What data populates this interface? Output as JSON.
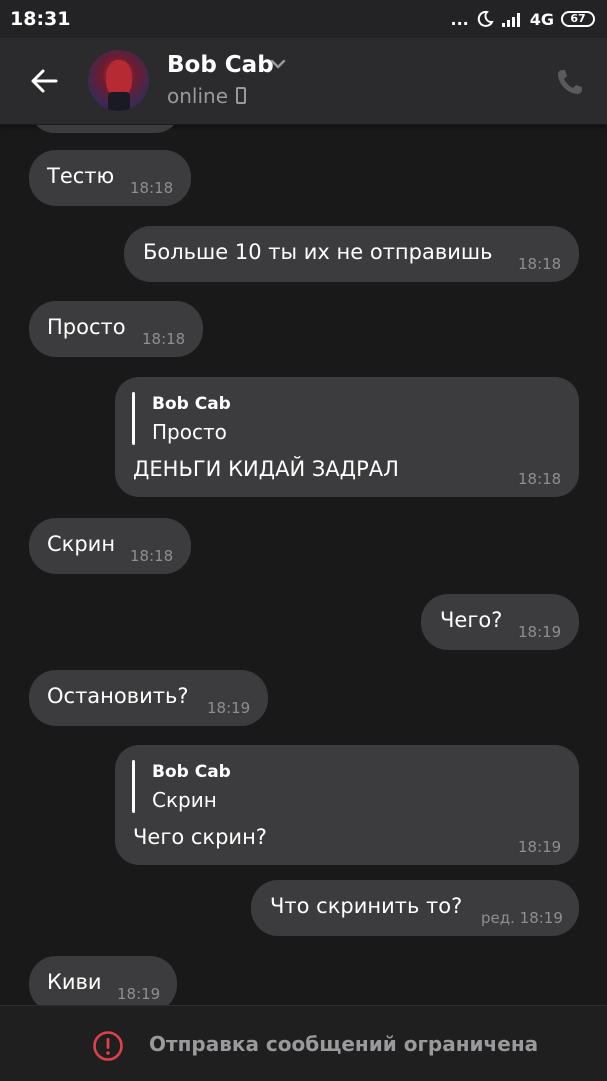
{
  "status_bar": {
    "time": "18:31",
    "dots": "...",
    "network": "4G",
    "battery": "67"
  },
  "header": {
    "contact_name": "Bob Cab",
    "contact_status": "online",
    "accent_icon_color": "#9a9a9c"
  },
  "messages": [
    {
      "side": "in",
      "text": "Тестю",
      "time": "18:18"
    },
    {
      "side": "out",
      "text": "Больше 10 ты их не отправишь",
      "time": "18:18"
    },
    {
      "side": "in",
      "text": "Просто",
      "time": "18:18"
    },
    {
      "side": "out",
      "reply_name": "Bob Cab",
      "reply_text": "Просто",
      "text": "ДЕНЬГИ КИДАЙ ЗАДРАЛ",
      "time": "18:18"
    },
    {
      "side": "in",
      "text": "Скрин",
      "time": "18:18"
    },
    {
      "side": "out",
      "text": "Чего?",
      "time": "18:19"
    },
    {
      "side": "in",
      "text": "Остановить?",
      "time": "18:19"
    },
    {
      "side": "out",
      "reply_name": "Bob Cab",
      "reply_text": "Скрин",
      "text": "Чего скрин?",
      "time": "18:19"
    },
    {
      "side": "out",
      "text": "Что скринить то?",
      "time": "ред. 18:19"
    },
    {
      "side": "in",
      "text": "Киви",
      "time": "18:19"
    }
  ],
  "bottom_bar": {
    "restriction_text": "Отправка сообщений ограничена",
    "warning_color": "#e0404a"
  }
}
